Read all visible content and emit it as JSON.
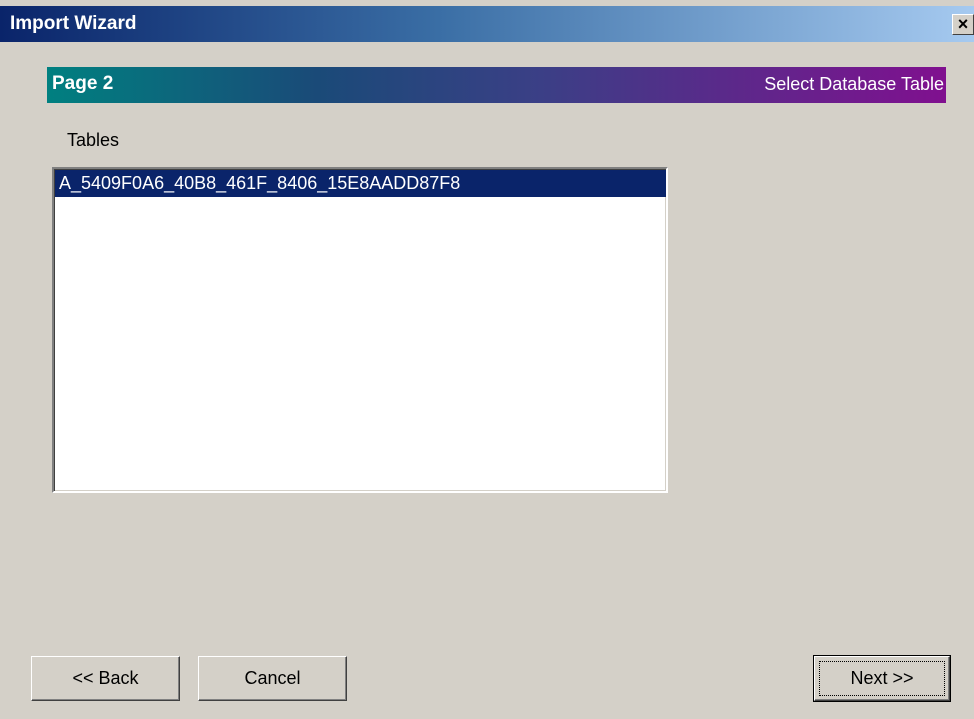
{
  "window": {
    "title": "Import Wizard",
    "close_label": "×"
  },
  "banner": {
    "page": "Page 2",
    "description": "Select Database Table"
  },
  "tables": {
    "label": "Tables",
    "items": [
      {
        "name": "A_5409F0A6_40B8_461F_8406_15E8AADD87F8",
        "selected": true
      }
    ]
  },
  "buttons": {
    "back": "<< Back",
    "cancel": "Cancel",
    "next": "Next >>"
  },
  "colors": {
    "selection": "#0a246a",
    "face": "#d4d0c8"
  }
}
